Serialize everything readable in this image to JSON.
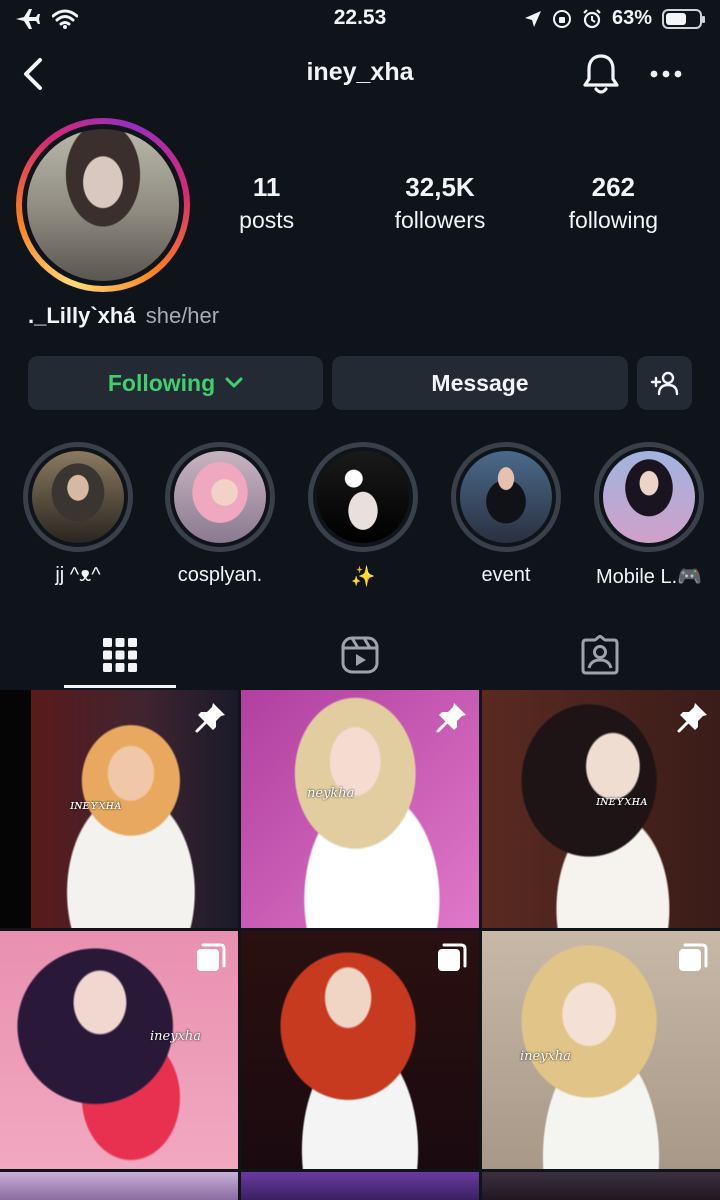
{
  "status_bar": {
    "time": "22.53",
    "battery_percent_text": "63%",
    "battery_level": 0.63
  },
  "header": {
    "username": "iney_xha"
  },
  "profile": {
    "stats": [
      {
        "num": "11",
        "label": "posts"
      },
      {
        "num": "32,5K",
        "label": "followers"
      },
      {
        "num": "262",
        "label": "following"
      }
    ],
    "name": "._Lilly`xhá",
    "pronouns": "she/her"
  },
  "actions": {
    "following_label": "Following",
    "message_label": "Message"
  },
  "highlights": [
    {
      "label": "jj ^ᴥ^"
    },
    {
      "label": "cosplyan."
    },
    {
      "label": "✨"
    },
    {
      "label": "event"
    },
    {
      "label": "Mobile L.🎮"
    }
  ],
  "tabs": [
    {
      "name": "grid",
      "icon": "grid-icon",
      "active": true
    },
    {
      "name": "reels",
      "icon": "reels-icon",
      "active": false
    },
    {
      "name": "tagged",
      "icon": "tagged-icon",
      "active": false
    }
  ],
  "posts": [
    {
      "watermark": "ɪɴᴇʏxʜᴀ",
      "badge": "pin-icon"
    },
    {
      "watermark": "neykha",
      "badge": "pin-icon"
    },
    {
      "watermark": "ɪɴᴇʏxʜᴀ",
      "badge": "pin-icon"
    },
    {
      "watermark": "ineyxha",
      "badge": "carousel-icon"
    },
    {
      "watermark": "",
      "badge": "carousel-icon"
    },
    {
      "watermark": "ineyxha",
      "badge": "carousel-icon"
    }
  ],
  "colors": {
    "background": "#0f141b",
    "button": "#242a33",
    "following_green": "#3fcf6e"
  }
}
